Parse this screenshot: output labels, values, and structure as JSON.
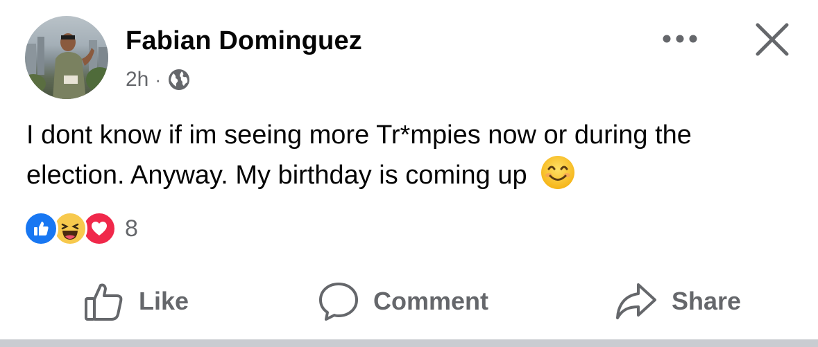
{
  "post": {
    "author": "Fabian Dominguez",
    "timestamp": "2h",
    "separator": "·",
    "audience_icon": "globe-icon",
    "text": "I dont know if im seeing more Tr*mpies now or during the election. Anyway. My birthday is coming up",
    "emoji": "smiling-face-emoji"
  },
  "reactions": {
    "types": [
      "like",
      "haha",
      "love"
    ],
    "count": "8"
  },
  "actions": {
    "like_label": "Like",
    "comment_label": "Comment",
    "share_label": "Share"
  },
  "header": {
    "more_icon": "more-icon",
    "close_icon": "close-icon"
  },
  "colors": {
    "like_blue": "#1877f2",
    "haha_yellow": "#f7c94d",
    "love_red": "#f0284a",
    "secondary_text": "#65676b",
    "primary_text": "#050505"
  }
}
